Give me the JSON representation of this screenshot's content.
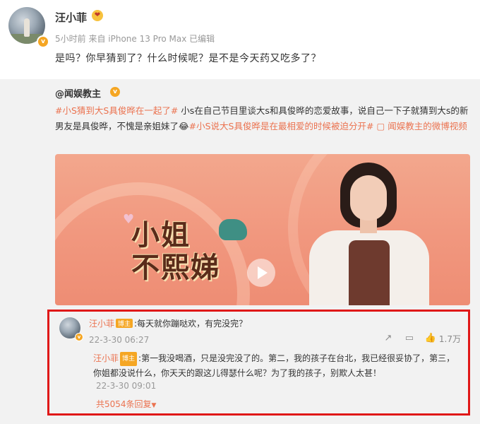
{
  "post": {
    "username": "汪小菲",
    "meta": "5小时前  来自 iPhone 13 Pro Max 已编辑",
    "text": "是吗？你早猜到了？什么时候呢？是不是今天药又吃多了？"
  },
  "repost": {
    "author": "@闻娱教主",
    "text_parts": [
      {
        "t": "#小S猜到大S具俊晔在一起了#",
        "tag": true
      },
      {
        "t": " 小s在自己节目里谈大s和具俊晔的恋爱故事，说自己一下子就猜到大s的新男友是具俊晔，不愧是亲姐妹了",
        "tag": false
      },
      {
        "t": "😂",
        "tag": false
      },
      {
        "t": "#小S说大S具俊晔是在最相爱的时候被迫分开#",
        "tag": true
      },
      {
        "t": " ",
        "tag": false
      },
      {
        "t": "▢ 闻娱教主的微博视频",
        "tag": true
      }
    ],
    "video": {
      "show_title_line1": "小姐",
      "show_title_line2": "不熙娣"
    }
  },
  "comment": {
    "name": "汪小菲",
    "badge": "博主",
    "text": ":每天就你蹦哒欢，有完没完？",
    "time": "22-3-30 06:27",
    "likes": "1.7万",
    "reply": {
      "name": "汪小菲",
      "badge": "博主",
      "text": ":第一我没喝酒，只是没完没了的。第二，我的孩子在台北，我已经很妥协了，第三，你姐都没说什么，你天天的跟这儿得瑟什么呢？为了我的孩子，别欺人太甚！",
      "time": "22-3-30 09:01",
      "more": "共5054条回复"
    }
  }
}
